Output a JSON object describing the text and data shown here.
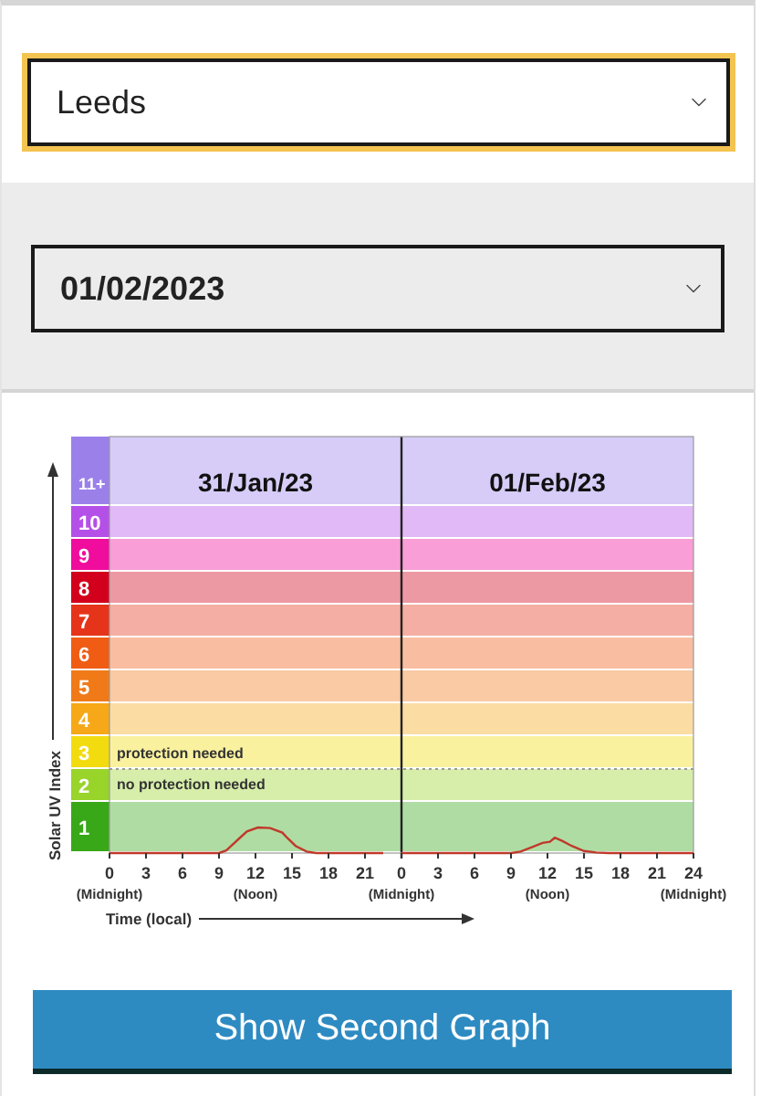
{
  "location_select": {
    "value": "Leeds",
    "focused": true
  },
  "date_select": {
    "value": "01/02/2023",
    "focused": false
  },
  "uv_chart": {
    "ylabel": "Solar UV Index",
    "xlabel": "Time (local)",
    "protection_above": "protection needed",
    "protection_below": "no protection needed",
    "bands": [
      {
        "label": "11+",
        "color": "#9b80ea"
      },
      {
        "label": "10",
        "color": "#b450e8"
      },
      {
        "label": "9",
        "color": "#f00c9c"
      },
      {
        "label": "8",
        "color": "#d2001c"
      },
      {
        "label": "7",
        "color": "#e6341a"
      },
      {
        "label": "6",
        "color": "#f05c14"
      },
      {
        "label": "5",
        "color": "#f07a18"
      },
      {
        "label": "4",
        "color": "#f6a818"
      },
      {
        "label": "3",
        "color": "#f2dc10"
      },
      {
        "label": "2",
        "color": "#98d42a"
      },
      {
        "label": "1",
        "color": "#38a818"
      }
    ],
    "days": [
      {
        "title": "31/Jan/23",
        "ticks": [
          "0",
          "3",
          "6",
          "9",
          "12",
          "15",
          "18",
          "21"
        ],
        "notes": [
          "(Midnight)",
          "(Noon)"
        ]
      },
      {
        "title": "01/Feb/23",
        "ticks": [
          "0",
          "3",
          "6",
          "9",
          "12",
          "15",
          "18",
          "21",
          "24"
        ],
        "notes": [
          "(Midnight)",
          "(Noon)",
          "(Midnight)"
        ]
      }
    ]
  },
  "button": {
    "label": "Show Second Graph"
  }
}
